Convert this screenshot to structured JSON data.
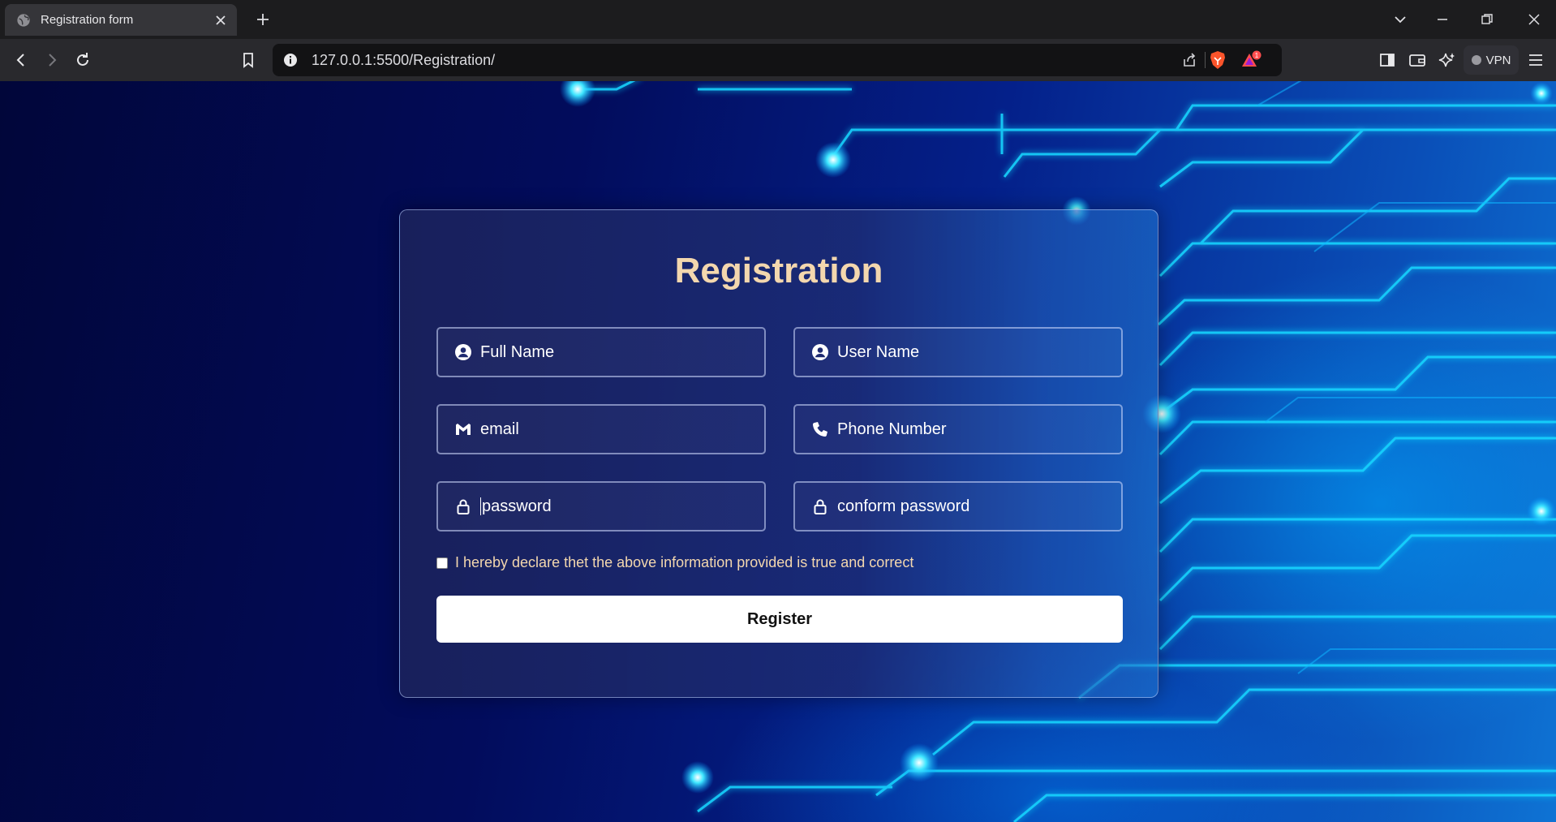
{
  "browser": {
    "tab_title": "Registration form",
    "url": "127.0.0.1:5500/Registration/",
    "vpn_label": "VPN",
    "notification_count": "1"
  },
  "form": {
    "title": "Registration",
    "fields": {
      "full_name": "Full Name",
      "user_name": "User Name",
      "email": "email",
      "phone": "Phone Number",
      "password": "password",
      "confirm_password": "conform password"
    },
    "declaration": "I hereby declare thet the above information provided is true and correct",
    "declaration_checked": false,
    "register_label": "Register"
  },
  "colors": {
    "title_accent": "#f3d7ae",
    "background_deep": "#020c5c",
    "circuit_glow": "#19d6ff"
  }
}
